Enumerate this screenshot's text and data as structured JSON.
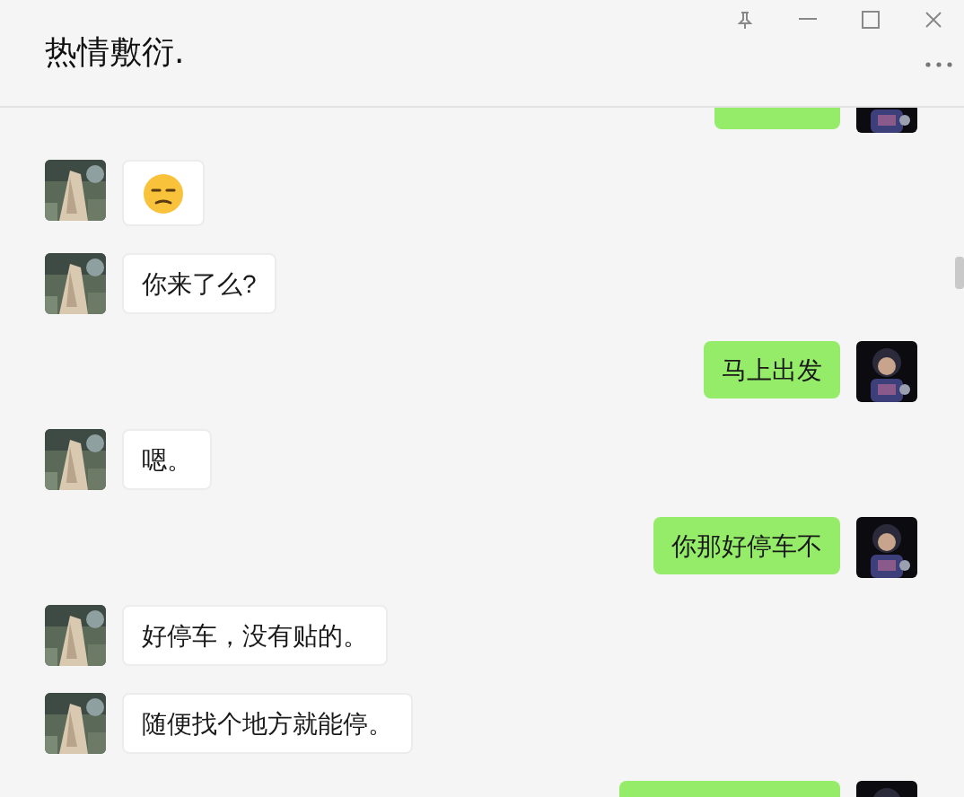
{
  "window": {
    "title": "热情敷衍."
  },
  "messages": [
    {
      "kind": "partial",
      "outgoing": true
    },
    {
      "kind": "emoji",
      "outgoing": false
    },
    {
      "kind": "text",
      "outgoing": false,
      "text": "你来了么?"
    },
    {
      "kind": "text",
      "outgoing": true,
      "text": "马上出发"
    },
    {
      "kind": "text",
      "outgoing": false,
      "text": "嗯。"
    },
    {
      "kind": "text",
      "outgoing": true,
      "text": "你那好停车不"
    },
    {
      "kind": "text",
      "outgoing": false,
      "text": "好停车，没有贴的。"
    },
    {
      "kind": "text",
      "outgoing": false,
      "text": "随便找个地方就能停。"
    },
    {
      "kind": "partial",
      "outgoing": true
    }
  ]
}
